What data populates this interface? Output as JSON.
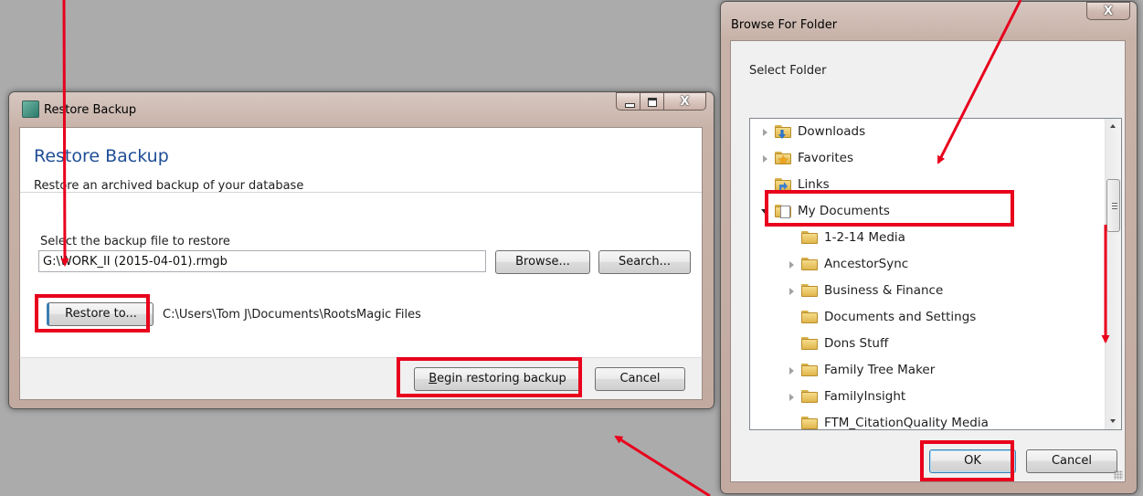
{
  "restore_window": {
    "title": "Restore Backup",
    "heading": "Restore Backup",
    "subheading": "Restore an archived backup of your database",
    "file_label": "Select the backup file to restore",
    "file_value": "G:\\WORK_II (2015-04-01).rmgb",
    "browse_label": "Browse...",
    "search_label": "Search...",
    "restore_to_label": "Restore to...",
    "restore_path": "C:\\Users\\Tom J\\Documents\\RootsMagic Files",
    "begin_label": "Begin restoring backup",
    "begin_mnemonic": "B",
    "begin_rest": "egin restoring backup",
    "cancel_label": "Cancel",
    "close_glyph": "X"
  },
  "browse_window": {
    "title": "Browse For Folder",
    "instruction": "Select Folder",
    "ok_label": "OK",
    "cancel_label": "Cancel",
    "close_glyph": "X",
    "tree": [
      {
        "label": "Downloads",
        "icon": "downloads-folder-icon"
      },
      {
        "label": "Favorites",
        "icon": "favorites-folder-icon"
      },
      {
        "label": "Links",
        "icon": "links-folder-icon"
      },
      {
        "label": "My Documents",
        "icon": "documents-folder-icon"
      },
      {
        "label": "1-2-14 Media",
        "icon": "folder-icon"
      },
      {
        "label": "AncestorSync",
        "icon": "folder-icon"
      },
      {
        "label": "Business & Finance",
        "icon": "folder-icon"
      },
      {
        "label": "Documents and Settings",
        "icon": "folder-icon"
      },
      {
        "label": "Dons Stuff",
        "icon": "folder-icon"
      },
      {
        "label": "Family Tree Maker",
        "icon": "folder-icon"
      },
      {
        "label": "FamilyInsight",
        "icon": "folder-icon"
      },
      {
        "label": "FTM_CitationQuality Media",
        "icon": "folder-icon"
      }
    ]
  },
  "colors": {
    "annotation_red": "#e8001c",
    "heading_blue": "#1f4e96",
    "desktop_gray": "#ababab"
  }
}
